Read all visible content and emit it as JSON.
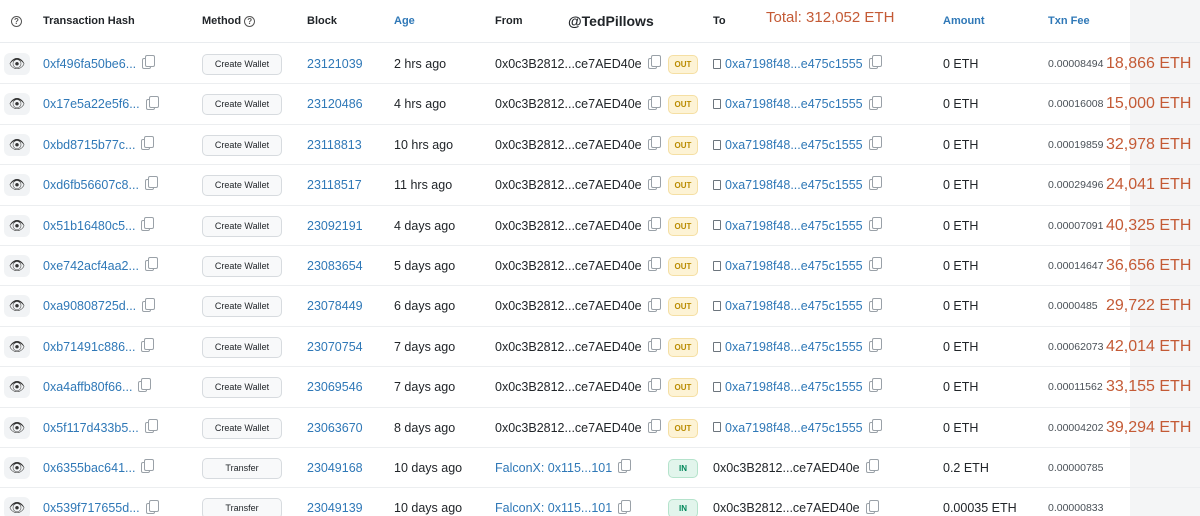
{
  "header": {
    "transaction_hash": "Transaction Hash",
    "method": "Method",
    "block": "Block",
    "age": "Age",
    "from": "From",
    "watermark": "@TedPillows",
    "to": "To",
    "total": "Total: 312,052 ETH",
    "amount": "Amount",
    "txn_fee": "Txn Fee"
  },
  "rows": [
    {
      "hash": "0xf496fa50be6...",
      "method": "Create Wallet",
      "block": "23121039",
      "age": "2 hrs ago",
      "from": "0x0c3B2812...ce7AED40e",
      "direction": "OUT",
      "to": "0xa7198f48...e475c1555",
      "amount": "0 ETH",
      "fee": "0.00008494",
      "annotation": "18,866 ETH"
    },
    {
      "hash": "0x17e5a22e5f6...",
      "method": "Create Wallet",
      "block": "23120486",
      "age": "4 hrs ago",
      "from": "0x0c3B2812...ce7AED40e",
      "direction": "OUT",
      "to": "0xa7198f48...e475c1555",
      "amount": "0 ETH",
      "fee": "0.00016008",
      "annotation": "15,000 ETH"
    },
    {
      "hash": "0xbd8715b77c...",
      "method": "Create Wallet",
      "block": "23118813",
      "age": "10 hrs ago",
      "from": "0x0c3B2812...ce7AED40e",
      "direction": "OUT",
      "to": "0xa7198f48...e475c1555",
      "amount": "0 ETH",
      "fee": "0.00019859",
      "annotation": "32,978 ETH"
    },
    {
      "hash": "0xd6fb56607c8...",
      "method": "Create Wallet",
      "block": "23118517",
      "age": "11 hrs ago",
      "from": "0x0c3B2812...ce7AED40e",
      "direction": "OUT",
      "to": "0xa7198f48...e475c1555",
      "amount": "0 ETH",
      "fee": "0.00029496",
      "annotation": "24,041 ETH"
    },
    {
      "hash": "0x51b16480c5...",
      "method": "Create Wallet",
      "block": "23092191",
      "age": "4 days ago",
      "from": "0x0c3B2812...ce7AED40e",
      "direction": "OUT",
      "to": "0xa7198f48...e475c1555",
      "amount": "0 ETH",
      "fee": "0.00007091",
      "annotation": "40,325 ETH"
    },
    {
      "hash": "0xe742acf4aa2...",
      "method": "Create Wallet",
      "block": "23083654",
      "age": "5 days ago",
      "from": "0x0c3B2812...ce7AED40e",
      "direction": "OUT",
      "to": "0xa7198f48...e475c1555",
      "amount": "0 ETH",
      "fee": "0.00014647",
      "annotation": "36,656 ETH"
    },
    {
      "hash": "0xa90808725d...",
      "method": "Create Wallet",
      "block": "23078449",
      "age": "6 days ago",
      "from": "0x0c3B2812...ce7AED40e",
      "direction": "OUT",
      "to": "0xa7198f48...e475c1555",
      "amount": "0 ETH",
      "fee": "0.0000485",
      "annotation": "29,722 ETH"
    },
    {
      "hash": "0xb71491c886...",
      "method": "Create Wallet",
      "block": "23070754",
      "age": "7 days ago",
      "from": "0x0c3B2812...ce7AED40e",
      "direction": "OUT",
      "to": "0xa7198f48...e475c1555",
      "amount": "0 ETH",
      "fee": "0.00062073",
      "annotation": "42,014 ETH"
    },
    {
      "hash": "0xa4affb80f66...",
      "method": "Create Wallet",
      "block": "23069546",
      "age": "7 days ago",
      "from": "0x0c3B2812...ce7AED40e",
      "direction": "OUT",
      "to": "0xa7198f48...e475c1555",
      "amount": "0 ETH",
      "fee": "0.00011562",
      "annotation": "33,155 ETH"
    },
    {
      "hash": "0x5f117d433b5...",
      "method": "Create Wallet",
      "block": "23063670",
      "age": "8 days ago",
      "from": "0x0c3B2812...ce7AED40e",
      "direction": "OUT",
      "to": "0xa7198f48...e475c1555",
      "amount": "0 ETH",
      "fee": "0.00004202",
      "annotation": "39,294 ETH"
    },
    {
      "hash": "0x6355bac641...",
      "method": "Transfer",
      "block": "23049168",
      "age": "10 days ago",
      "from": "FalconX: 0x115...101",
      "direction": "IN",
      "to": "0x0c3B2812...ce7AED40e",
      "amount": "0.2 ETH",
      "fee": "0.00000785",
      "annotation": ""
    },
    {
      "hash": "0x539f717655d...",
      "method": "Transfer",
      "block": "23049139",
      "age": "10 days ago",
      "from": "FalconX: 0x115...101",
      "direction": "IN",
      "to": "0x0c3B2812...ce7AED40e",
      "amount": "0.00035 ETH",
      "fee": "0.00000833",
      "annotation": ""
    }
  ],
  "colors": {
    "link": "#2f78b7",
    "annotation": "#c45a35",
    "out_badge": "#fdf3d5",
    "in_badge": "#e2f5ec"
  }
}
